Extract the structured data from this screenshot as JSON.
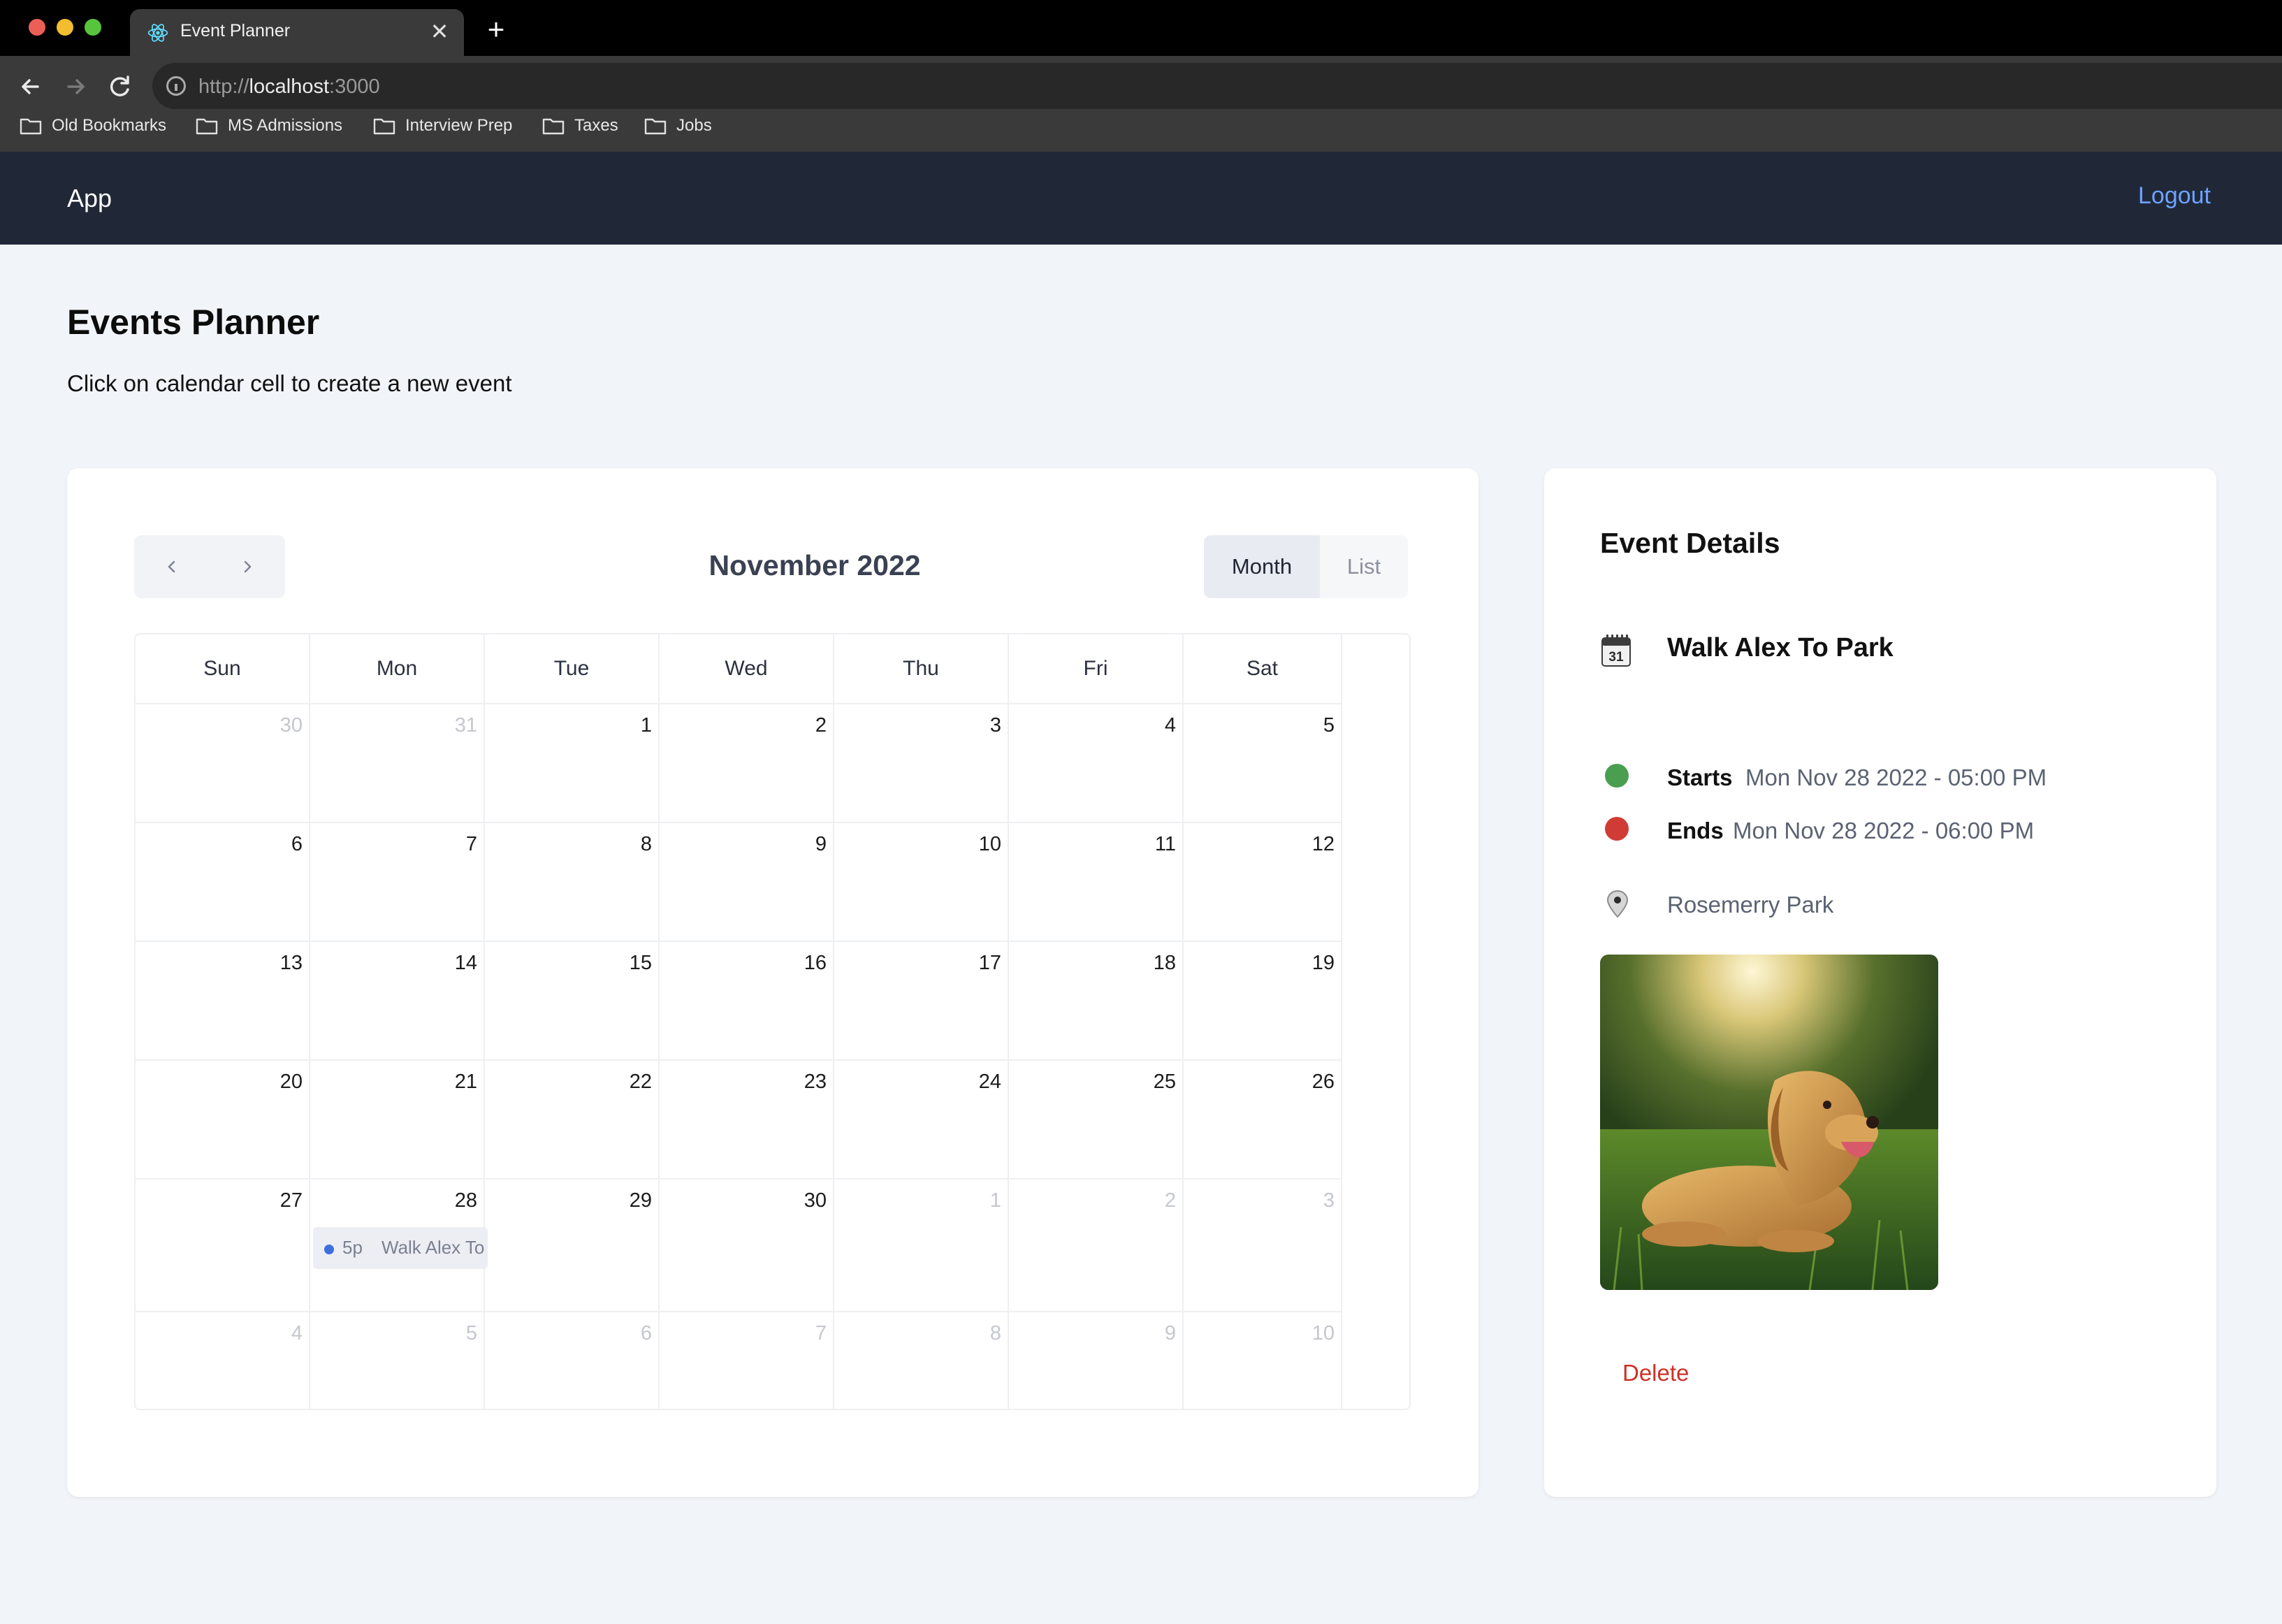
{
  "browser": {
    "tab_title": "Event Planner",
    "url_scheme": "http://",
    "url_host": "localhost",
    "url_port": ":3000",
    "bookmarks": [
      "Old Bookmarks",
      "MS Admissions",
      "Interview Prep",
      "Taxes",
      "Jobs"
    ]
  },
  "header": {
    "brand": "App",
    "logout_label": "Logout"
  },
  "page": {
    "title": "Events Planner",
    "subtitle": "Click on calendar cell to create a new event"
  },
  "calendar": {
    "month_label": "November 2022",
    "view_month_label": "Month",
    "view_list_label": "List",
    "days_of_week": [
      "Sun",
      "Mon",
      "Tue",
      "Wed",
      "Thu",
      "Fri",
      "Sat"
    ],
    "weeks": [
      [
        "30",
        "31",
        "1",
        "2",
        "3",
        "4",
        "5"
      ],
      [
        "6",
        "7",
        "8",
        "9",
        "10",
        "11",
        "12"
      ],
      [
        "13",
        "14",
        "15",
        "16",
        "17",
        "18",
        "19"
      ],
      [
        "20",
        "21",
        "22",
        "23",
        "24",
        "25",
        "26"
      ],
      [
        "27",
        "28",
        "29",
        "30",
        "1",
        "2",
        "3"
      ],
      [
        "4",
        "5",
        "6",
        "7",
        "8",
        "9",
        "10"
      ]
    ],
    "event": {
      "time": "5p",
      "title": "Walk Alex To",
      "color": "#3e6fe0"
    }
  },
  "details": {
    "heading": "Event Details",
    "calendar_icon_text": "31",
    "event_title": "Walk Alex To Park",
    "starts_label": "Starts",
    "starts_value": "Mon Nov 28 2022 - 05:00 PM",
    "ends_label": "Ends",
    "ends_value": "Mon Nov 28 2022 - 06:00 PM",
    "location": "Rosemerry Park",
    "delete_label": "Delete"
  },
  "colors": {
    "start": "#4a9e4f",
    "end": "#d03c35",
    "accent": "#6ea2ff",
    "danger": "#cc3127"
  }
}
